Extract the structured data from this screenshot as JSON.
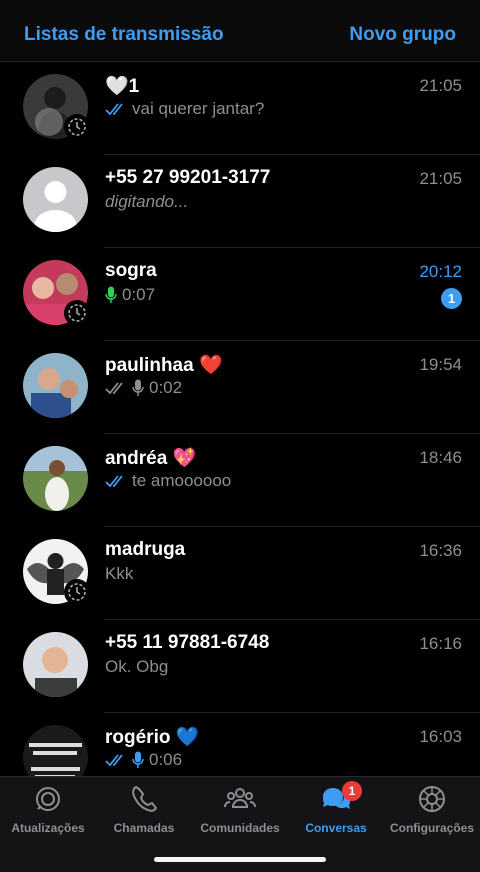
{
  "header": {
    "left_action": "Listas de transmissão",
    "right_action": "Novo grupo"
  },
  "chats": [
    {
      "name": "🤍1",
      "time": "21:05",
      "preview": "vai querer jantar?",
      "ticks": "read",
      "status": true
    },
    {
      "name": "+55 27 99201-3177",
      "time": "21:05",
      "preview": "digitando...",
      "typing": true
    },
    {
      "name": "sogra",
      "time": "20:12",
      "preview": "0:07",
      "voice": "green",
      "unread": "1",
      "status": true
    },
    {
      "name": "paulinhaa ❤️",
      "time": "19:54",
      "preview": "0:02",
      "ticks": "delivered",
      "voice": "gray"
    },
    {
      "name": "andréa 💖",
      "time": "18:46",
      "preview": "te amoooooo",
      "ticks": "read"
    },
    {
      "name": "madruga",
      "time": "16:36",
      "preview": "Kkk",
      "status": true
    },
    {
      "name": "+55 11 97881-6748",
      "time": "16:16",
      "preview": "Ok. Obg"
    },
    {
      "name": "rogério 💙",
      "time": "16:03",
      "preview": "0:06",
      "ticks": "read",
      "voice": "blue"
    }
  ],
  "tabs": [
    {
      "label": "Atualizações",
      "icon": "status-icon"
    },
    {
      "label": "Chamadas",
      "icon": "phone-icon"
    },
    {
      "label": "Comunidades",
      "icon": "communities-icon"
    },
    {
      "label": "Conversas",
      "icon": "chats-icon",
      "active": true,
      "badge": "1"
    },
    {
      "label": "Configurações",
      "icon": "gear-icon"
    }
  ],
  "colors": {
    "accent": "#3e9df3",
    "voice_green": "#30d158",
    "badge_red": "#ea3b3b",
    "secondary_text": "#8e8e93"
  }
}
